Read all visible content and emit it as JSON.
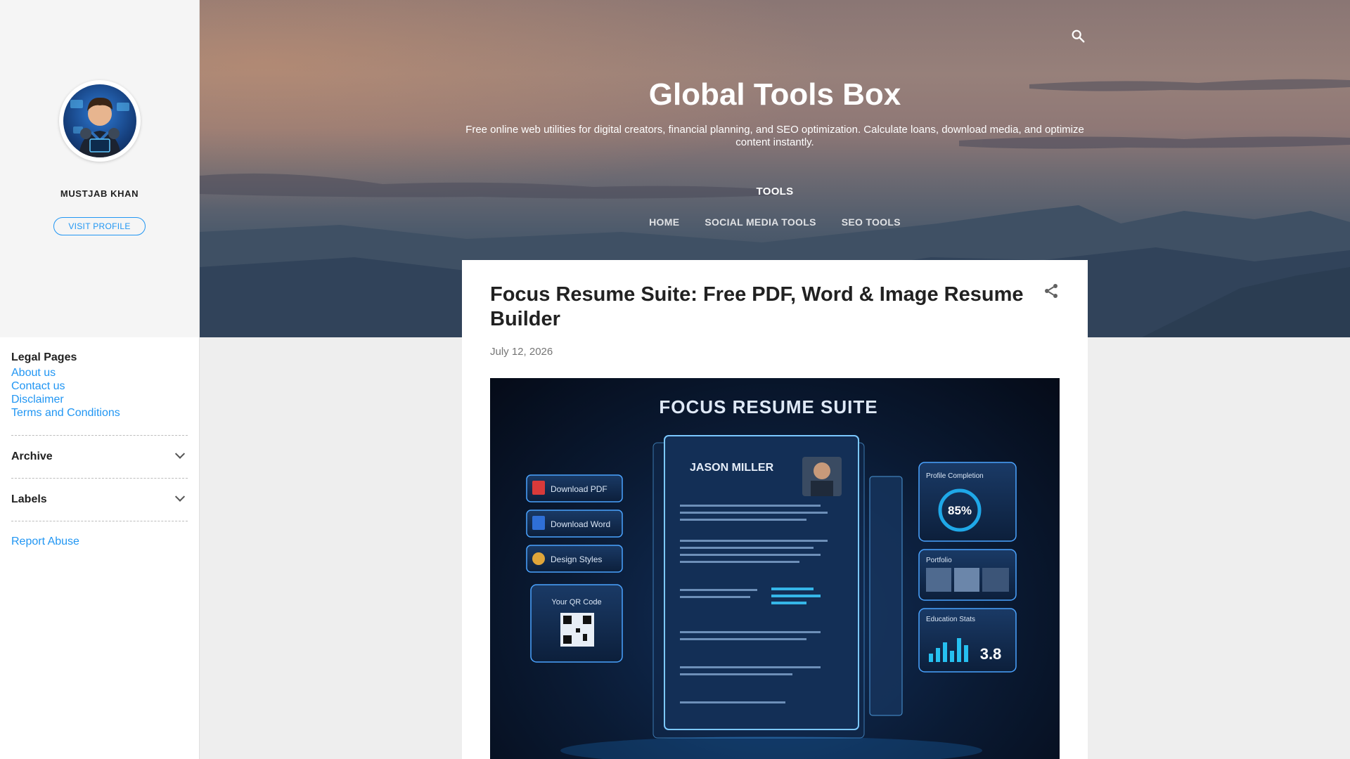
{
  "sidebar": {
    "profile_name": "MUSTJAB KHAN",
    "visit_profile_label": "VISIT PROFILE",
    "legal": {
      "title": "Legal Pages",
      "links": [
        "About us",
        "Contact us",
        "Disclaimer",
        "Terms and Conditions"
      ]
    },
    "archive_label": "Archive",
    "labels_label": "Labels",
    "report_abuse_label": "Report Abuse"
  },
  "header": {
    "title": "Global Tools Box",
    "description": "Free online web utilities for digital creators, financial planning, and SEO optimization. Calculate loans, download media, and optimize content instantly.",
    "nav_heading": "TOOLS",
    "nav_items": [
      "HOME",
      "SOCIAL MEDIA TOOLS",
      "SEO TOOLS"
    ]
  },
  "post": {
    "title": "Focus Resume Suite: Free PDF, Word & Image Resume Builder",
    "date": "July 12, 2026",
    "image": {
      "heading": "FOCUS RESUME SUITE",
      "name": "JASON MILLER",
      "buttons": [
        "Download PDF",
        "Download Word",
        "Design Styles"
      ],
      "qr_label": "Your QR Code",
      "profile_completion_label": "Profile Completion",
      "profile_completion_value": "85%",
      "portfolio_label": "Portfolio",
      "education_label": "Education Stats",
      "gpa_value": "3.8"
    }
  },
  "colors": {
    "accent": "#2196f3",
    "sidebar_bg": "#ffffff",
    "profile_bg": "#f5f5f5",
    "page_bg": "#eeeeee"
  },
  "icons": [
    "search-icon",
    "share-icon",
    "chevron-down-icon"
  ]
}
